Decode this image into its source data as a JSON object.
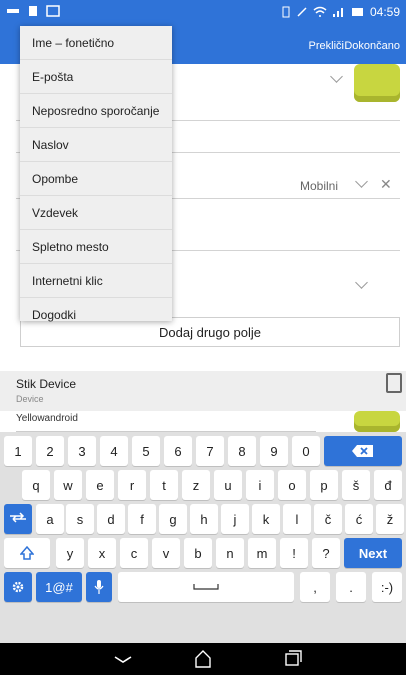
{
  "status_bar": {
    "time": "04:59"
  },
  "app_bar": {
    "cancel_label": "Prekliči",
    "done_label": "Dokončano"
  },
  "form": {
    "phone_type": "Mobilni",
    "add_field_label": "Dodaj drugo polje"
  },
  "account_section": {
    "name": "Stik Device",
    "type": "Device",
    "field_text": "Yellowandroid"
  },
  "dropdown_menu": {
    "items": [
      "Ime – fonetično",
      "E-pošta",
      "Neposredno sporočanje",
      "Naslov",
      "Opombe",
      "Vzdevek",
      "Spletno mesto",
      "Internetni klic",
      "Dogodki"
    ]
  },
  "keyboard": {
    "row1": [
      "1",
      "2",
      "3",
      "4",
      "5",
      "6",
      "7",
      "8",
      "9",
      "0"
    ],
    "row2": [
      "q",
      "w",
      "e",
      "r",
      "t",
      "z",
      "u",
      "i",
      "o",
      "p",
      "š",
      "đ"
    ],
    "row3": [
      "a",
      "s",
      "d",
      "f",
      "g",
      "h",
      "j",
      "k",
      "l",
      "č",
      "ć",
      "ž"
    ],
    "row4": [
      "y",
      "x",
      "c",
      "v",
      "b",
      "n",
      "m",
      "!",
      "?"
    ],
    "next_label": "Next",
    "symbols_label": "1@#",
    "comma": ",",
    "period": ".",
    "smiley": ":-)"
  },
  "colors": {
    "accent": "#2f73d8",
    "keyboard_bg": "#e0e0e0",
    "nav_bg": "#000000"
  }
}
